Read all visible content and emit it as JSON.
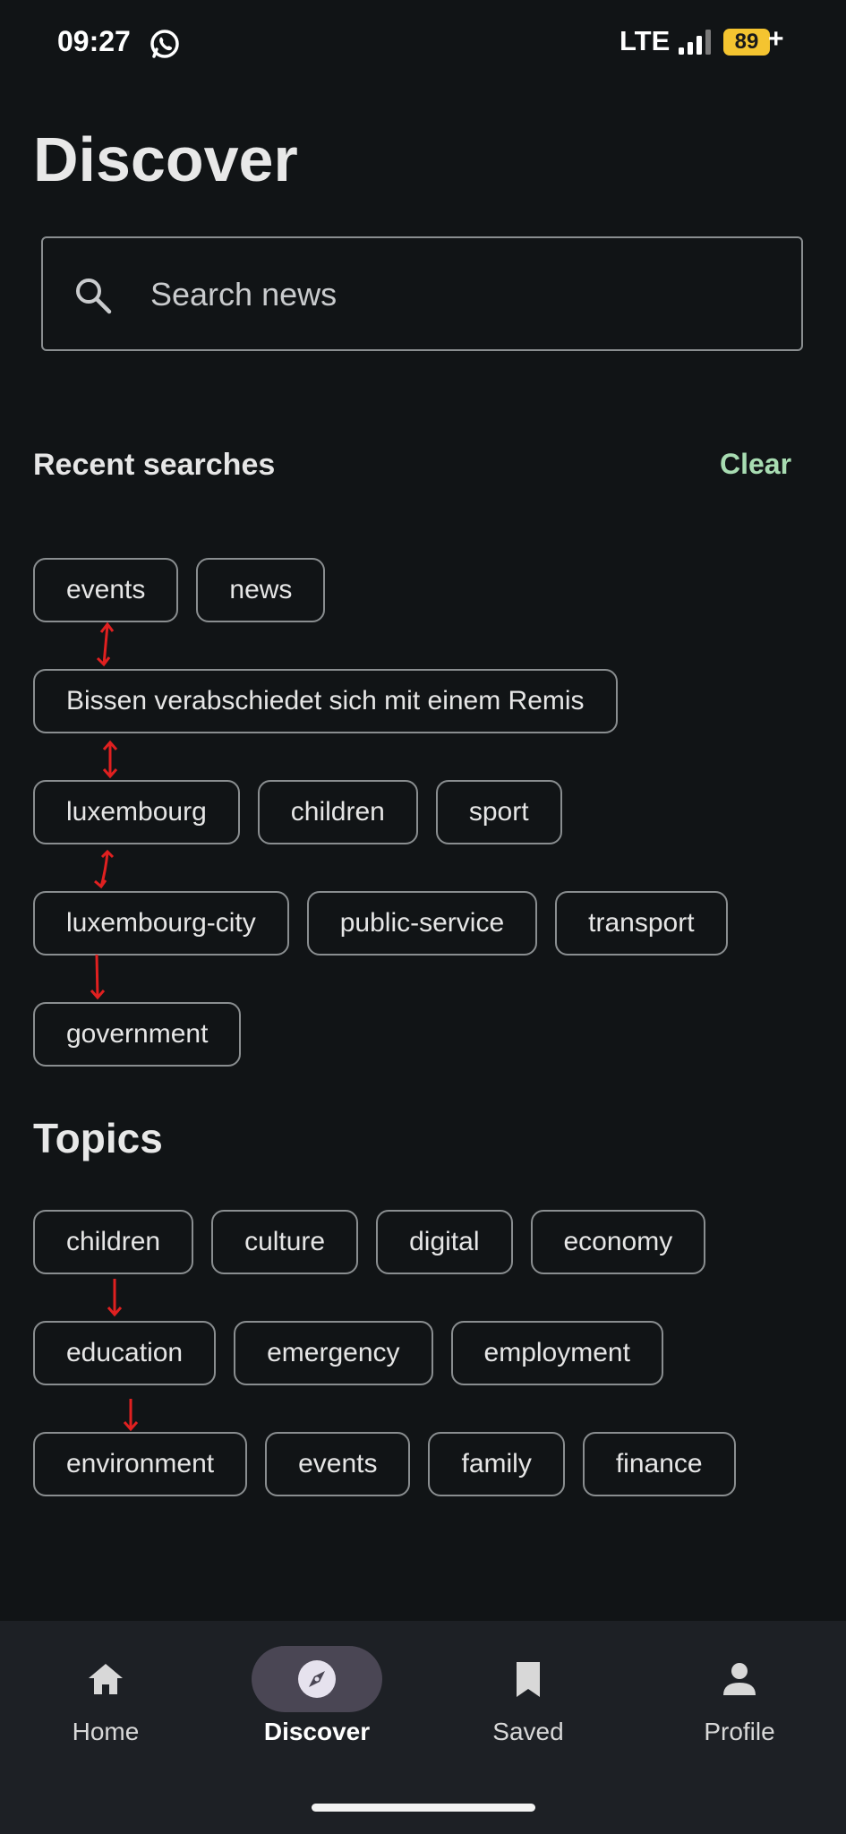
{
  "status_bar": {
    "time": "09:27",
    "network": "LTE",
    "battery": "89",
    "battery_suffix": "+",
    "battery_color": "#f4c430"
  },
  "page": {
    "title": "Discover"
  },
  "search": {
    "placeholder": "Search news",
    "value": ""
  },
  "recent": {
    "heading": "Recent searches",
    "clear_label": "Clear",
    "rows": [
      [
        "events",
        "news"
      ],
      [
        "Bissen verabschiedet sich mit einem Remis"
      ],
      [
        "luxembourg",
        "children",
        "sport"
      ],
      [
        "luxembourg-city",
        "public-service",
        "transport"
      ],
      [
        "government"
      ]
    ]
  },
  "topics": {
    "heading": "Topics",
    "rows": [
      [
        "children",
        "culture",
        "digital",
        "economy"
      ],
      [
        "education",
        "emergency",
        "employment"
      ],
      [
        "environment",
        "events",
        "family",
        "finance"
      ]
    ]
  },
  "bottom_nav": {
    "items": [
      {
        "label": "Home",
        "icon": "home-icon",
        "active": false
      },
      {
        "label": "Discover",
        "icon": "compass-icon",
        "active": true
      },
      {
        "label": "Saved",
        "icon": "bookmark-icon",
        "active": false
      },
      {
        "label": "Profile",
        "icon": "person-icon",
        "active": false
      }
    ]
  },
  "colors": {
    "background": "#111416",
    "accent": "#a8dcb2",
    "chip_border": "#8a8e90",
    "nav_background": "#1d2025",
    "annotation_red": "#e02020"
  }
}
